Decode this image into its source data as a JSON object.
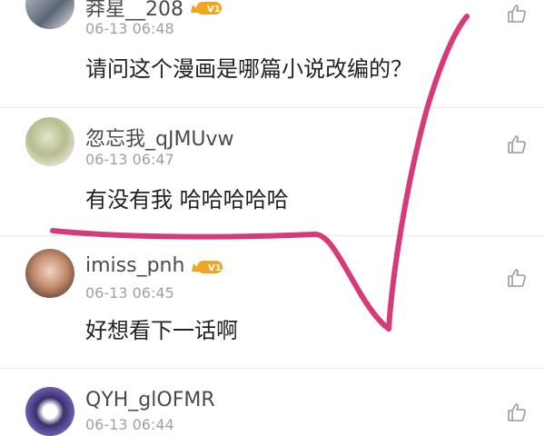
{
  "comments": [
    {
      "username": "莽星__208",
      "time": "06-13 06:48",
      "text": "请问这个漫画是哪篇小说改编的？",
      "vip": "V1"
    },
    {
      "username": "忽忘我_qJMUvw",
      "time": "06-13 06:47",
      "text": "有没有我 哈哈哈哈哈"
    },
    {
      "username": "imiss_pnh",
      "time": "06-13 06:45",
      "text": "好想看下一话啊",
      "vip": "V1"
    },
    {
      "username": "QYH_glOFMR",
      "time": "06-13 06:44"
    }
  ],
  "colors": {
    "annotation": "#d63a78",
    "vip_badge": "#f0a623"
  },
  "icons": {
    "like": "thumbs-up-icon",
    "badge": "vip-badge-icon",
    "mark": "checkmark-annotation"
  }
}
